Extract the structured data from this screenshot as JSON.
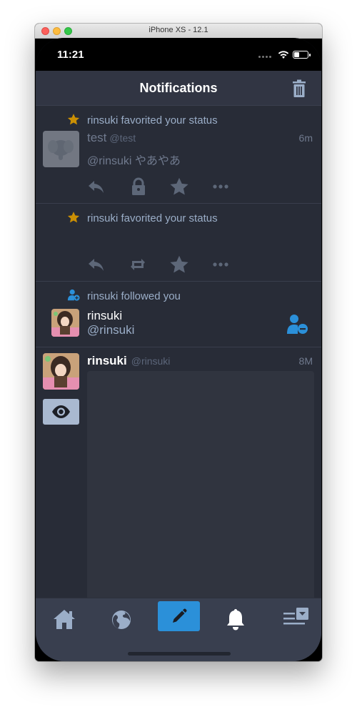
{
  "window": {
    "title": "iPhone XS - 12.1"
  },
  "status_bar": {
    "time": "11:21"
  },
  "nav": {
    "title": "Notifications",
    "trash_icon": "trash-icon"
  },
  "notifications": [
    {
      "type": "favourite",
      "text": "rinsuki favorited your status",
      "status": {
        "display_name": "test",
        "handle": "@test",
        "time": "6m",
        "body": "@rinsuki やあやあ"
      },
      "actions": [
        "reply-icon",
        "lock-icon",
        "star-icon",
        "more-icon"
      ]
    },
    {
      "type": "favourite",
      "text": "rinsuki favorited your status",
      "actions": [
        "reply-icon",
        "boost-icon",
        "star-icon",
        "more-icon"
      ]
    },
    {
      "type": "follow",
      "text": "rinsuki followed you",
      "account": {
        "display_name": "rinsuki",
        "handle": "@rinsuki"
      }
    },
    {
      "type": "status",
      "status": {
        "display_name": "rinsuki",
        "handle": "@rinsuki",
        "time": "8M"
      },
      "sensitive_toggle_icon": "eye-icon"
    }
  ],
  "tabbar": {
    "items": [
      "home-icon",
      "globe-icon",
      "compose-icon",
      "bell-icon",
      "lists-icon"
    ]
  },
  "colors": {
    "background": "#282c37",
    "navbar": "#313543",
    "tabbar": "#393f4f",
    "accent": "#2b90d9",
    "star": "#ca8f04",
    "muted_text": "#9baec8"
  }
}
